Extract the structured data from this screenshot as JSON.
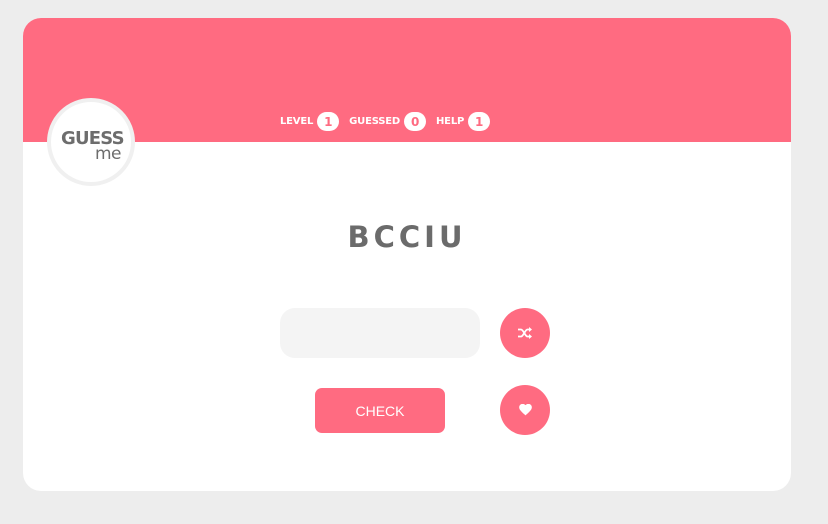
{
  "stats": [
    {
      "label": "LEVEL",
      "value": "1"
    },
    {
      "label": "GUESSED",
      "value": "0"
    },
    {
      "label": "HELP",
      "value": "1"
    }
  ],
  "logo": {
    "main": "GUESS",
    "sub": "me"
  },
  "puzzle": {
    "scrambled_word": "BCCIU"
  },
  "guess_input": {
    "value": "",
    "placeholder": ""
  },
  "buttons": {
    "check_label": "CHECK",
    "shuffle_icon": "shuffle-icon",
    "help_icon": "heart-icon"
  },
  "colors": {
    "accent": "#ff6b81",
    "background": "#ededed",
    "card": "#ffffff",
    "text": "#6b6b6b",
    "input_bg": "#f4f4f4"
  }
}
